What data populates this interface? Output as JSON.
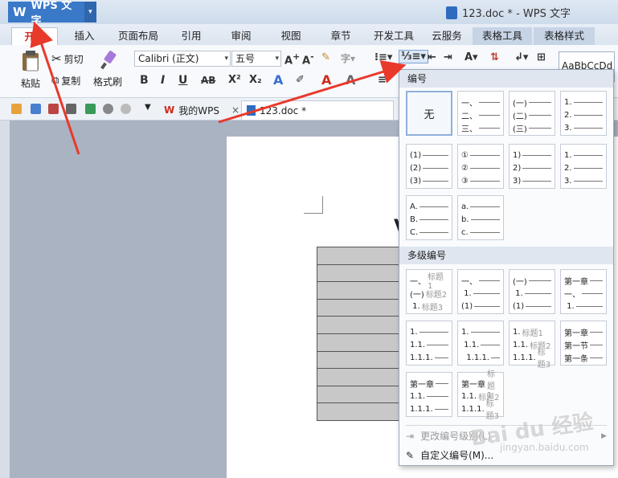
{
  "app": {
    "logo_label": "WPS 文字",
    "window_title": "123.doc * - WPS 文字"
  },
  "menu_tabs": [
    {
      "label": "开始",
      "active": true
    },
    {
      "label": "插入"
    },
    {
      "label": "页面布局"
    },
    {
      "label": "引用"
    },
    {
      "label": "审阅"
    },
    {
      "label": "视图"
    },
    {
      "label": "章节"
    },
    {
      "label": "开发工具"
    },
    {
      "label": "云服务"
    },
    {
      "label": "表格工具"
    },
    {
      "label": "表格样式"
    }
  ],
  "ribbon": {
    "paste": "粘贴",
    "cut": "剪切",
    "copy": "复制",
    "format_painter": "格式刷",
    "font_name": "Calibri (正文)",
    "font_size": "五号",
    "bold": "B",
    "italic": "I",
    "underline": "U",
    "strike": "AB",
    "superscript": "X²",
    "subscript": "X₂",
    "style_preview": "AaBbCcDd"
  },
  "doc_tabs": [
    {
      "label": "我的WPS"
    },
    {
      "label": "123.doc *",
      "active": true
    }
  ],
  "numbering_menu": {
    "section1_title": "编号",
    "none_label": "无",
    "section2_title": "多级编号",
    "change_level": "更改编号级别(L)",
    "custom": "自定义编号(M)..."
  },
  "numbering_cells": [
    [
      "一、",
      "二、",
      "三、"
    ],
    [
      "(一)",
      "(二)",
      "(三)"
    ],
    [
      "1.",
      "2.",
      "3."
    ],
    [
      "(1)",
      "(2)",
      "(3)"
    ],
    [
      "①",
      "②",
      "③"
    ],
    [
      "1)",
      "2)",
      "3)"
    ],
    [
      "1.",
      "2.",
      "3."
    ],
    [
      "A.",
      "B.",
      "C."
    ],
    [
      "a.",
      "b.",
      "c."
    ]
  ],
  "multilevel_cells": [
    [
      [
        "一、",
        "标题1"
      ],
      [
        "(一)",
        "标题2"
      ],
      [
        " 1.",
        "标题3"
      ]
    ],
    [
      [
        "一、",
        ""
      ],
      [
        " 1.",
        ""
      ],
      [
        "(1)",
        ""
      ]
    ],
    [
      [
        "(一)",
        ""
      ],
      [
        " 1.",
        ""
      ],
      [
        "(1)",
        ""
      ]
    ],
    [
      [
        "第一章",
        ""
      ],
      [
        "一、",
        ""
      ],
      [
        " 1.",
        ""
      ]
    ],
    [
      [
        "1.",
        ""
      ],
      [
        "1.1.",
        ""
      ],
      [
        "1.1.1.",
        ""
      ]
    ],
    [
      [
        "1.",
        ""
      ],
      [
        " 1.1.",
        ""
      ],
      [
        "  1.1.1.",
        ""
      ]
    ],
    [
      [
        "1.",
        "标题1"
      ],
      [
        "1.1.",
        "标题2"
      ],
      [
        "1.1.1.",
        "标题3"
      ]
    ],
    [
      [
        "第一章",
        ""
      ],
      [
        "第一节",
        ""
      ],
      [
        "第一条",
        ""
      ]
    ],
    [
      [
        "第一章",
        ""
      ],
      [
        "1.1.",
        ""
      ],
      [
        "1.1.1.",
        ""
      ]
    ],
    [
      [
        "第一章",
        "标题1"
      ],
      [
        "1.1.",
        "标题2"
      ],
      [
        "1.1.1.",
        "标题3"
      ]
    ]
  ],
  "watermark": {
    "main": "Bai du 经验",
    "sub": "jingyan.baidu.com"
  },
  "colors": {
    "accent_red": "#d02a1a",
    "title_blue": "#3a78c8",
    "arrow": "#e8392b"
  }
}
